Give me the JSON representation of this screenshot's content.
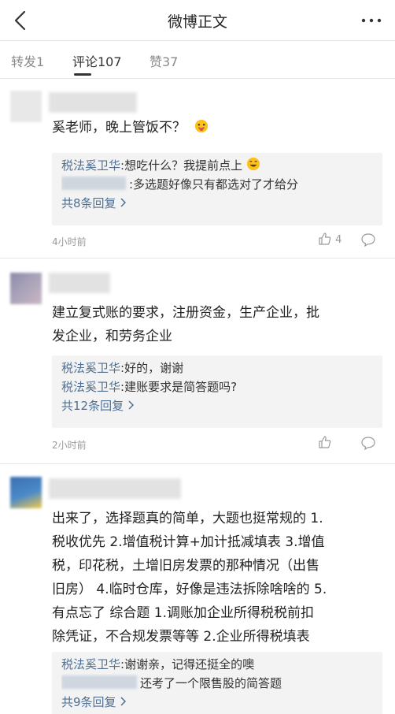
{
  "header": {
    "title": "微博正文"
  },
  "tabs": [
    {
      "label": "转发1"
    },
    {
      "label": "评论107"
    },
    {
      "label": "赞37"
    }
  ],
  "comments": [
    {
      "text": "奚老师，晚上管饭不？",
      "replies": [
        {
          "author": "税法奚卫华",
          "text": ":想吃什么？我提前点上"
        },
        {
          "author": "",
          "text": ":多选题好像只有都选对了才给分"
        }
      ],
      "more_replies": "共8条回复",
      "time": "4小时前",
      "likes": "4"
    },
    {
      "text_lines": [
        "建立复式账的要求，注册资金，生产企业，批",
        "发企业，和劳务企业"
      ],
      "replies": [
        {
          "author": "税法奚卫华",
          "text": ":好的，谢谢"
        },
        {
          "author": "税法奚卫华",
          "text": ":建账要求是简答题吗?"
        }
      ],
      "more_replies": "共12条回复",
      "time": "2小时前",
      "likes": ""
    },
    {
      "text_lines": [
        "出来了，选择题真的简单，大题也挺常规的 1.",
        "税收优先 2.增值税计算+加计抵减填表 3.增值",
        "税，印花税，土增旧房发票的那种情况（出售",
        "旧房） 4.临时仓库，好像是违法拆除啥啥的 5.",
        "有点忘了 综合题 1.调账加企业所得税税前扣",
        "除凭证，不合规发票等等 2.企业所得税填表"
      ],
      "replies": [
        {
          "author": "税法奚卫华",
          "text": ":谢谢亲，记得还挺全的噢"
        },
        {
          "author": "",
          "text": "还考了一个限售股的简答题"
        }
      ],
      "more_replies": "共9条回复"
    }
  ],
  "colors": {
    "link": "#4f6f93",
    "reply_bg": "#f3f3f3",
    "muted": "#999999"
  },
  "icons": [
    "back-arrow-icon",
    "more-dots-icon",
    "thumbs-up-icon",
    "comment-bubble-icon",
    "tongue-emoji-icon",
    "grin-emoji-icon",
    "chevron-right-icon"
  ]
}
